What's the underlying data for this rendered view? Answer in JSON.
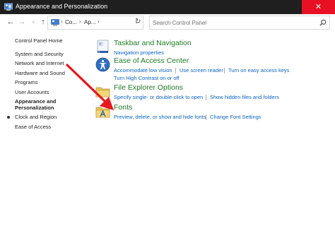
{
  "window": {
    "title": "Appearance and Personalization",
    "close_glyph": "✕"
  },
  "nav": {
    "back_glyph": "←",
    "forward_glyph": "→",
    "recent_glyph": "⌄",
    "up_glyph": "↑",
    "refresh_glyph": "↻",
    "address_crumbs": [
      "Co...",
      "Ap..."
    ],
    "address_separator": "›",
    "address_dropdown_glyph": "⌄",
    "search_placeholder": "Search Control Panel"
  },
  "sidebar": {
    "home": "Control Panel Home",
    "items": [
      "System and Security",
      "Network and Internet",
      "Hardware and Sound",
      "Programs",
      "User Accounts"
    ],
    "active": [
      "Appearance and",
      "Personalization"
    ],
    "after_active": [
      "Clock and Region",
      "Ease of Access"
    ]
  },
  "categories": [
    {
      "title": "Taskbar and Navigation",
      "icon": "taskbar-icon",
      "tasks": [
        "Navigation properties"
      ]
    },
    {
      "title": "Ease of Access Center",
      "icon": "ease-of-access-icon",
      "tasks": [
        "Accommodate low vision",
        "Use screen reader",
        "Turn on easy access keys",
        "Turn High Contrast on or off"
      ]
    },
    {
      "title": "File Explorer Options",
      "icon": "folder-options-icon",
      "tasks": [
        "Specify single- or double-click to open",
        "Show hidden files and folders"
      ]
    },
    {
      "title": "Fonts",
      "icon": "fonts-folder-icon",
      "tasks": [
        "Preview, delete, or show and hide fonts",
        "Change Font Settings"
      ]
    }
  ],
  "colors": {
    "category_title": "#1e7d23",
    "task_link": "#0b66c3",
    "close_button": "#e81123",
    "annotation_arrow": "#e8161d"
  }
}
